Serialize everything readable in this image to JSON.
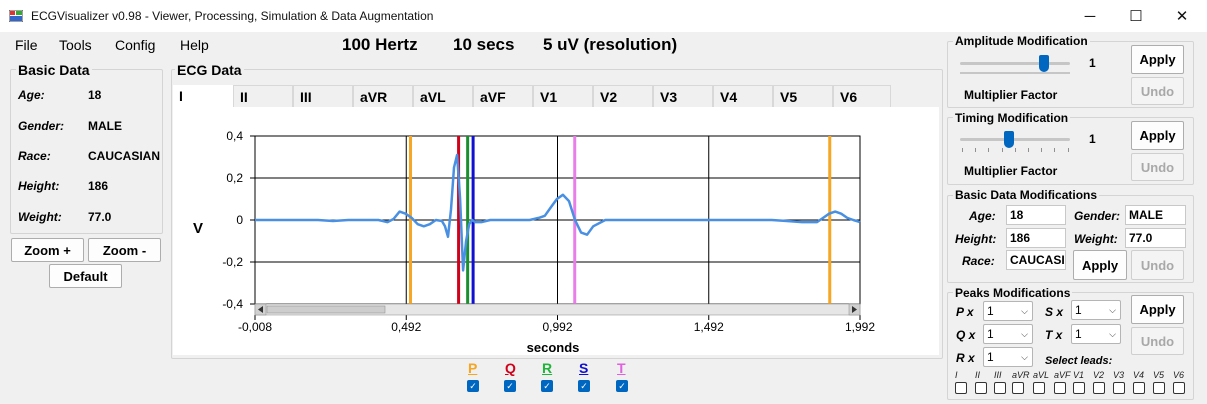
{
  "window": {
    "title": "ECGVisualizer v0.98 - Viewer, Processing, Simulation & Data Augmentation",
    "minimize_glyph": "─",
    "maximize_glyph": "☐",
    "close_glyph": "✕"
  },
  "menu": {
    "file": "File",
    "tools": "Tools",
    "config": "Config",
    "help": "Help"
  },
  "info": {
    "frequency": "100 Hertz",
    "duration": "10 secs",
    "resolution": "5 uV (resolution)"
  },
  "basic_data": {
    "title": "Basic Data",
    "fields": [
      {
        "label": "Age:",
        "value": "18"
      },
      {
        "label": "Gender:",
        "value": "MALE"
      },
      {
        "label": "Race:",
        "value": "CAUCASIAN"
      },
      {
        "label": "Height:",
        "value": "186"
      },
      {
        "label": "Weight:",
        "value": "77.0"
      }
    ]
  },
  "zoom": {
    "zoom_in": "Zoom +",
    "zoom_out": "Zoom -",
    "default": "Default"
  },
  "ecg": {
    "title": "ECG Data",
    "tabs": [
      "I",
      "II",
      "III",
      "aVR",
      "aVL",
      "aVF",
      "V1",
      "V2",
      "V3",
      "V4",
      "V5",
      "V6"
    ],
    "selected_tab": "I"
  },
  "chart_data": {
    "type": "line",
    "xlabel": "seconds",
    "ylabel": "V",
    "xlim": [
      -0.008,
      1.992
    ],
    "ylim": [
      -0.4,
      0.4
    ],
    "x_ticks": [
      "-0,008",
      "0,492",
      "0,992",
      "1,492",
      "1,992"
    ],
    "y_ticks": [
      "0,4",
      "0,2",
      "0",
      "-0,2",
      "-0,4"
    ],
    "grid": true,
    "series": [
      {
        "color": "#4a90e2",
        "x": [
          -0.008,
          0.05,
          0.1,
          0.15,
          0.2,
          0.25,
          0.3,
          0.35,
          0.4,
          0.43,
          0.45,
          0.47,
          0.49,
          0.51,
          0.53,
          0.55,
          0.57,
          0.59,
          0.61,
          0.62,
          0.63,
          0.64,
          0.65,
          0.66,
          0.67,
          0.68,
          0.69,
          0.7,
          0.71,
          0.72,
          0.74,
          0.77,
          0.8,
          0.85,
          0.9,
          0.93,
          0.95,
          0.97,
          0.99,
          1.01,
          1.03,
          1.05,
          1.07,
          1.09,
          1.11,
          1.15,
          1.2,
          1.3,
          1.4,
          1.5,
          1.6,
          1.7,
          1.75,
          1.8,
          1.85,
          1.87,
          1.89,
          1.91,
          1.93,
          1.95,
          1.97,
          1.992
        ],
        "y": [
          0.0,
          0.0,
          0.0,
          0.0,
          0.0,
          -0.005,
          0.0,
          0.0,
          0.0,
          -0.01,
          0.005,
          0.04,
          0.03,
          0.01,
          -0.02,
          -0.03,
          -0.02,
          0.0,
          -0.005,
          -0.03,
          -0.08,
          0.05,
          0.25,
          0.31,
          0.1,
          -0.24,
          -0.1,
          -0.02,
          0.0,
          -0.01,
          -0.01,
          0.0,
          0.0,
          0.0,
          0.0,
          0.01,
          0.02,
          0.06,
          0.1,
          0.12,
          0.09,
          0.0,
          -0.06,
          -0.07,
          -0.03,
          0.0,
          0.0,
          0.0,
          0.0,
          0.0,
          0.0,
          0.0,
          -0.005,
          -0.01,
          -0.01,
          0.01,
          0.03,
          0.04,
          0.03,
          0.01,
          0.0,
          -0.01
        ]
      }
    ],
    "markers": [
      {
        "x": 0.506,
        "color": "#f5a623"
      },
      {
        "x": 0.665,
        "color": "#d0021b"
      },
      {
        "x": 0.695,
        "color": "#1a8f2d"
      },
      {
        "x": 0.713,
        "color": "#1010d0"
      },
      {
        "x": 1.049,
        "color": "#e87ee8"
      },
      {
        "x": 1.892,
        "color": "#f5a623"
      }
    ]
  },
  "peak_legend": [
    {
      "label": "P",
      "color": "#f5a623"
    },
    {
      "label": "Q",
      "color": "#d0021b"
    },
    {
      "label": "R",
      "color": "#1fb53a"
    },
    {
      "label": "S",
      "color": "#1010d0"
    },
    {
      "label": "T",
      "color": "#e060e0"
    }
  ],
  "amplitude": {
    "title": "Amplitude Modification",
    "value": "1",
    "caption": "Multiplier Factor",
    "apply": "Apply",
    "undo": "Undo"
  },
  "timing": {
    "title": "Timing Modification",
    "value": "1",
    "caption": "Multiplier Factor",
    "apply": "Apply",
    "undo": "Undo"
  },
  "basic_mod": {
    "title": "Basic Data Modifications",
    "age_label": "Age:",
    "age": "18",
    "gender_label": "Gender:",
    "gender": "MALE",
    "height_label": "Height:",
    "height": "186",
    "weight_label": "Weight:",
    "weight": "77.0",
    "race_label": "Race:",
    "race": "CAUCASI",
    "apply": "Apply",
    "undo": "Undo"
  },
  "peaks_mod": {
    "title": "Peaks Modifications",
    "px_label": "P x",
    "px": "1",
    "qx_label": "Q x",
    "qx": "1",
    "rx_label": "R x",
    "rx": "1",
    "sx_label": "S x",
    "sx": "1",
    "tx_label": "T x",
    "tx": "1",
    "select_leads": "Select leads:",
    "leads": [
      "I",
      "II",
      "III",
      "aVR",
      "aVL",
      "aVF",
      "V1",
      "V2",
      "V3",
      "V4",
      "V5",
      "V6"
    ],
    "apply": "Apply",
    "undo": "Undo"
  }
}
